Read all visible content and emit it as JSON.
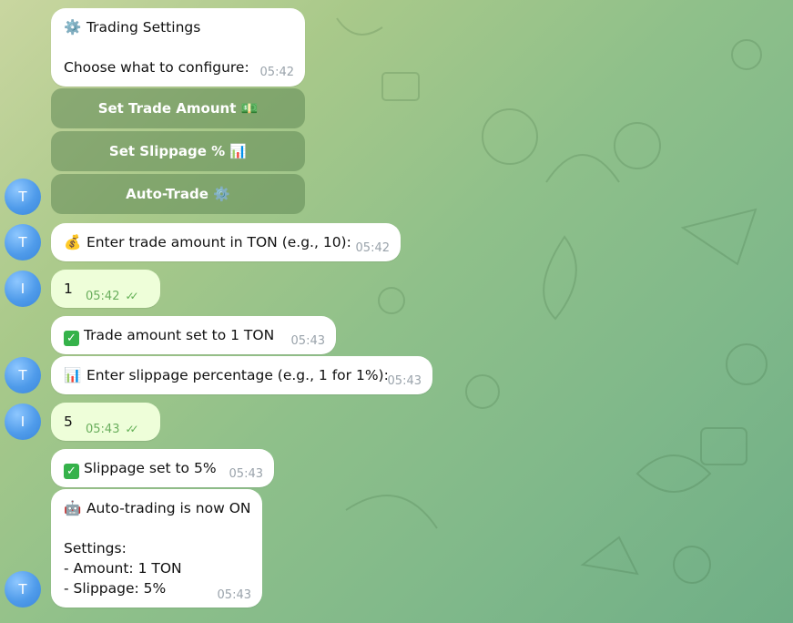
{
  "avatars": [
    "T",
    "T",
    "I",
    "T",
    "I",
    "T"
  ],
  "messages": {
    "settings": {
      "title": "Trading Settings",
      "subtitle": "Choose what to configure:",
      "time": "05:42"
    },
    "enter_amount": {
      "text": "Enter trade amount in TON (e.g., 10):",
      "time": "05:42"
    },
    "user_amount": {
      "text": "1",
      "time": "05:42"
    },
    "amount_set": {
      "text": "Trade amount set to 1 TON",
      "time": "05:43"
    },
    "enter_slippage": {
      "text": "Enter slippage percentage (e.g., 1 for 1%):",
      "time": "05:43"
    },
    "user_slippage": {
      "text": "5",
      "time": "05:43"
    },
    "slippage_set": {
      "text": "Slippage set to 5%",
      "time": "05:43"
    },
    "auto_on": {
      "line1": "Auto-trading is now ON",
      "line2": "Settings:",
      "line3": "- Amount: 1 TON",
      "line4": "- Slippage: 5%",
      "time": "05:43"
    }
  },
  "keyboard": {
    "set_amount": "Set Trade Amount",
    "set_slippage": "Set Slippage %",
    "auto_trade": "Auto-Trade"
  },
  "icons": {
    "gear": "gear-icon",
    "money_bag": "money-bag-icon",
    "bar_chart": "bar-chart-icon",
    "check": "check-mark-icon",
    "robot": "robot-icon"
  }
}
